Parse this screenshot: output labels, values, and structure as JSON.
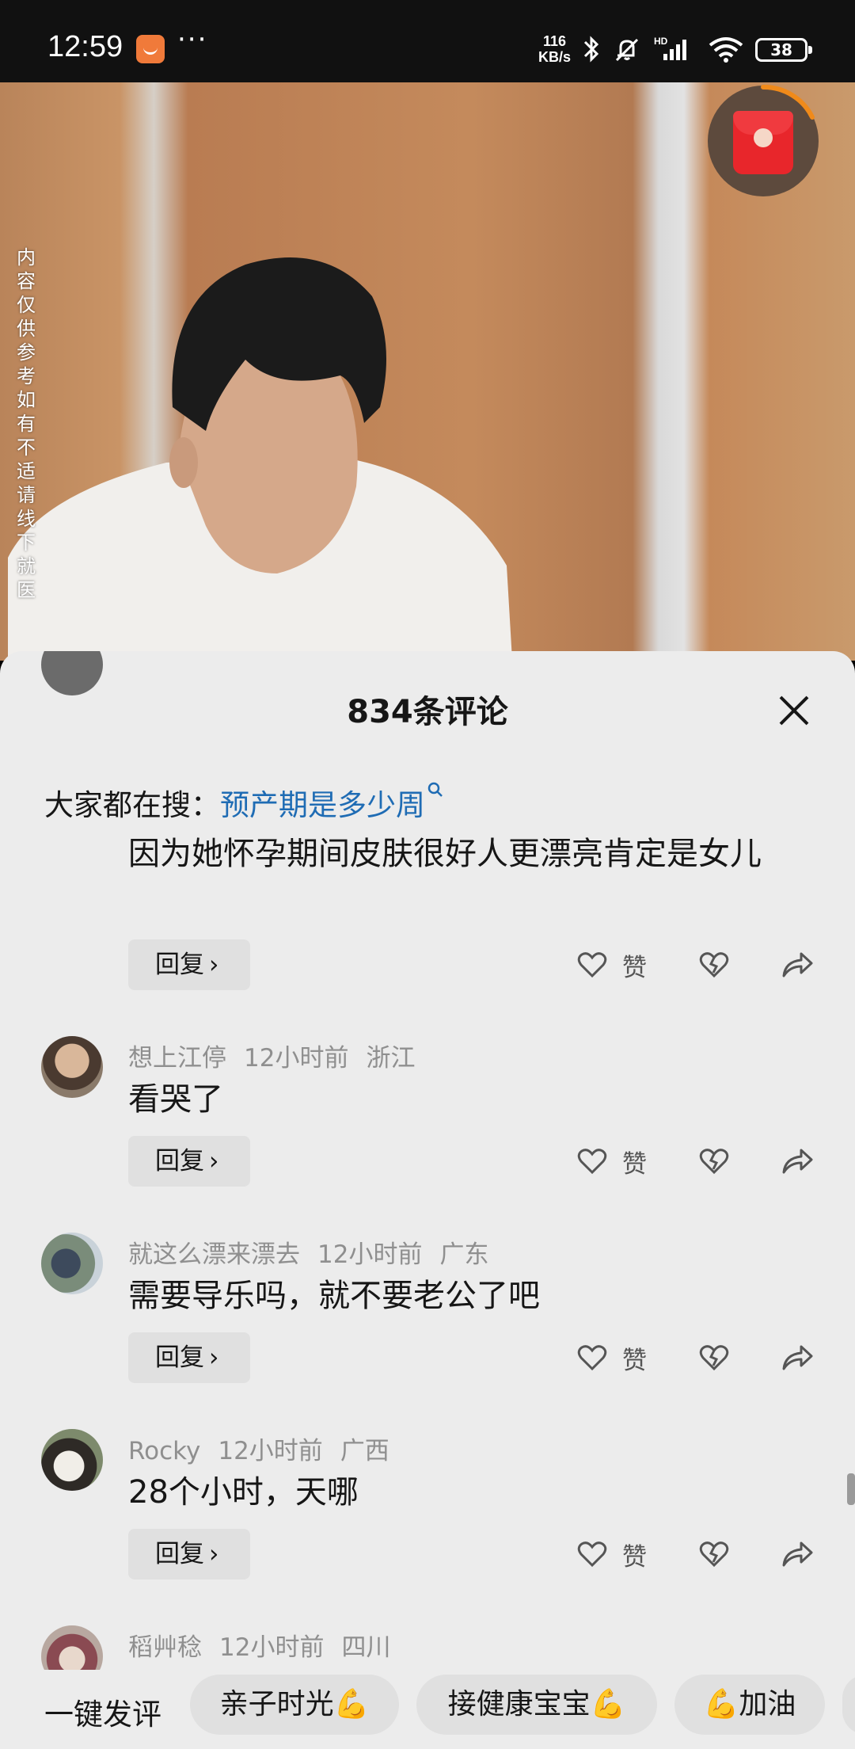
{
  "status_bar": {
    "time": "12:59",
    "net_speed_value": "116",
    "net_speed_unit": "KB/s",
    "battery": "38",
    "icons": [
      "app-notification-icon",
      "bluetooth-icon",
      "mute-icon",
      "hd-signal-icon",
      "wifi-icon",
      "battery-icon"
    ]
  },
  "video": {
    "side_note": "内容仅供参考 如有不适请线下就医",
    "redpack_icon": "red-envelope-icon"
  },
  "panel": {
    "title": "834条评论",
    "search_prefix": "大家都在搜：",
    "search_term": "预产期是多少周"
  },
  "actions": {
    "reply_label": "回复",
    "like_label": "赞"
  },
  "comments": [
    {
      "user": "",
      "time": "",
      "region": "",
      "text": "因为她怀孕期间皮肤很好人更漂亮肯定是女儿"
    },
    {
      "user": "想上江停",
      "time": "12小时前",
      "region": "浙江",
      "text": "看哭了"
    },
    {
      "user": "就这么漂来漂去",
      "time": "12小时前",
      "region": "广东",
      "text": "需要导乐吗，就不要老公了吧"
    },
    {
      "user": "Rocky",
      "time": "12小时前",
      "region": "广西",
      "text": "28个小时，天哪"
    },
    {
      "user": "稻艸稔",
      "time": "12小时前",
      "region": "四川",
      "text": ""
    }
  ],
  "quick_comments": {
    "label": "一键发评",
    "chips": [
      "亲子时光💪",
      "接健康宝宝💪",
      "💪加油"
    ]
  },
  "colors": {
    "panel_bg": "#ececec",
    "link_blue": "#1f6cb4",
    "meta_gray": "#8f8f8f"
  }
}
